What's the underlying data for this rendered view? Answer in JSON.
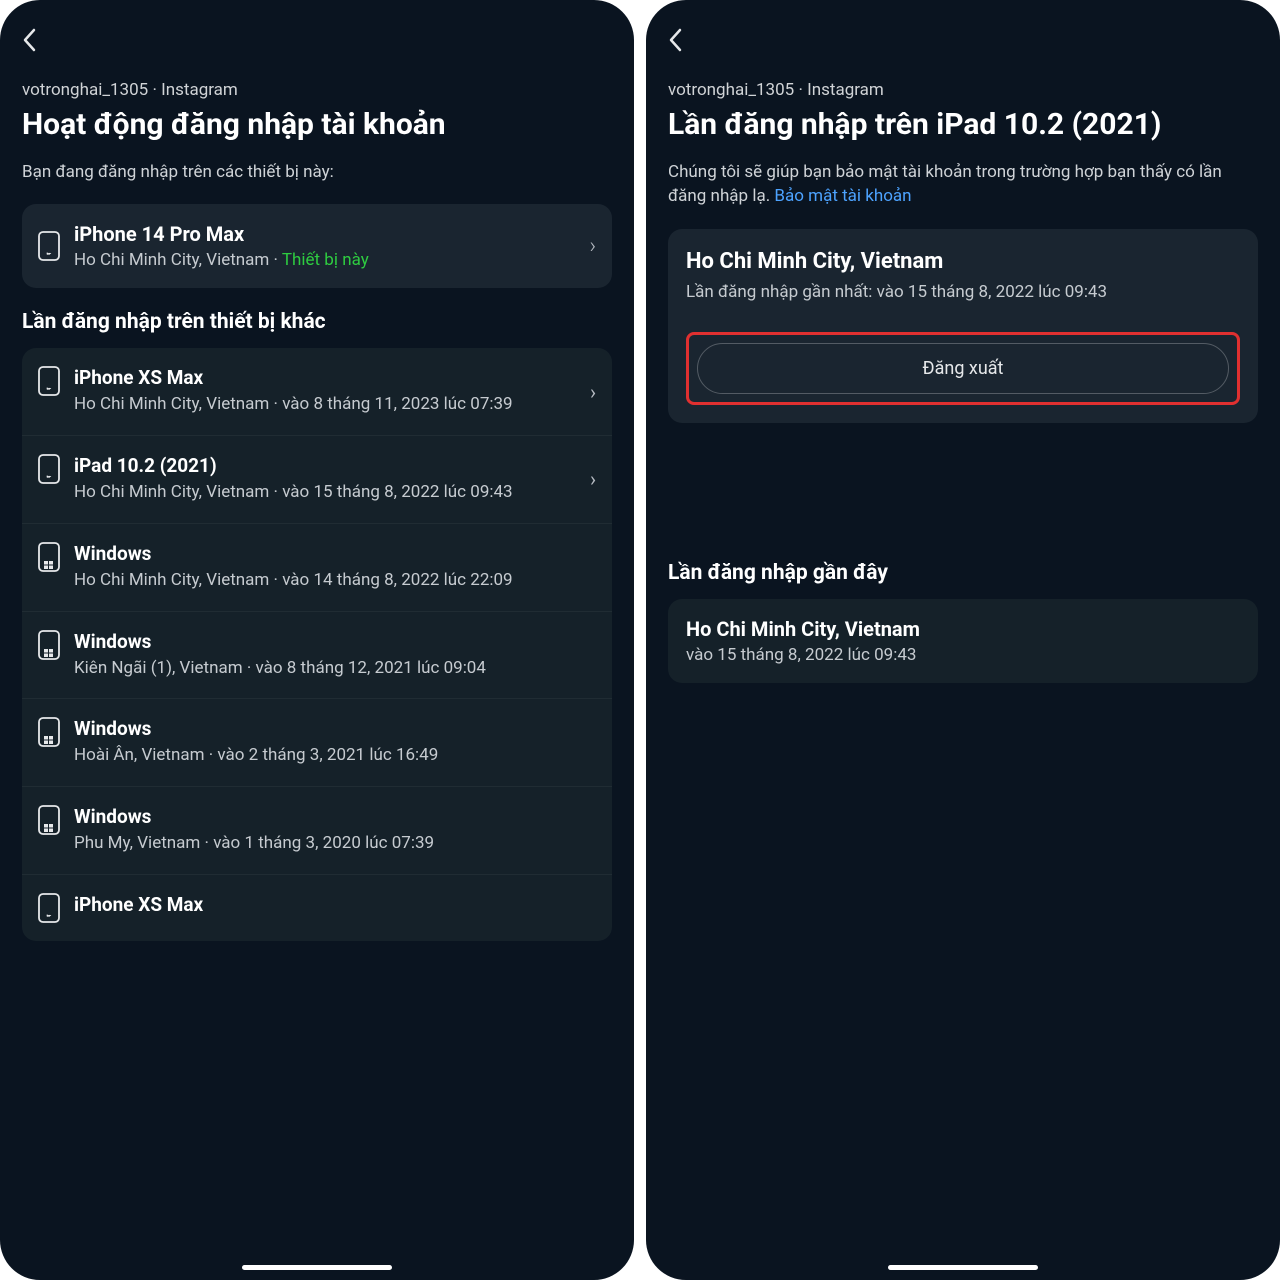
{
  "left": {
    "breadcrumb": "votronghai_1305 · Instagram",
    "title": "Hoạt động đăng nhập tài khoản",
    "subtitle": "Bạn đang đăng nhập trên các thiết bị này:",
    "current": {
      "device": "iPhone 14 Pro Max",
      "location": "Ho Chi Minh City, Vietnam",
      "separator": " · ",
      "this_device": "Thiết bị này"
    },
    "other_heading": "Lần đăng nhập trên thiết bị khác",
    "devices": [
      {
        "name": "iPhone XS Max",
        "sub": "Ho Chi Minh City, Vietnam · vào 8 tháng 11, 2023 lúc 07:39",
        "icon": "apple",
        "chevron": true
      },
      {
        "name": "iPad 10.2 (2021)",
        "sub": "Ho Chi Minh City, Vietnam · vào 15 tháng 8, 2022 lúc 09:43",
        "icon": "apple",
        "chevron": true
      },
      {
        "name": "Windows",
        "sub": "Ho Chi Minh City, Vietnam · vào 14 tháng 8, 2022 lúc 22:09",
        "icon": "windows",
        "chevron": false
      },
      {
        "name": "Windows",
        "sub": "Kiên Ngãi (1), Vietnam · vào 8 tháng 12, 2021 lúc 09:04",
        "icon": "windows",
        "chevron": false
      },
      {
        "name": "Windows",
        "sub": "Hoài Ân, Vietnam · vào 2 tháng 3, 2021 lúc 16:49",
        "icon": "windows",
        "chevron": false
      },
      {
        "name": "Windows",
        "sub": "Phu My, Vietnam · vào 1 tháng 3, 2020 lúc 07:39",
        "icon": "windows",
        "chevron": false
      },
      {
        "name": "iPhone XS Max",
        "sub": "",
        "icon": "apple",
        "chevron": false
      }
    ]
  },
  "right": {
    "breadcrumb": "votronghai_1305 · Instagram",
    "title": "Lần đăng nhập trên iPad 10.2 (2021)",
    "subtitle_text": "Chúng tôi sẽ giúp bạn bảo mật tài khoản trong trường hợp bạn thấy có lần đăng nhập lạ. ",
    "subtitle_link": "Bảo mật tài khoản",
    "detail": {
      "location": "Ho Chi Minh City, Vietnam",
      "last_login": "Lần đăng nhập gần nhất: vào 15 tháng 8, 2022 lúc 09:43"
    },
    "logout_label": "Đăng xuất",
    "recent_heading": "Lần đăng nhập gần đây",
    "recent": {
      "location": "Ho Chi Minh City, Vietnam",
      "time": "vào 15 tháng 8, 2022 lúc 09:43"
    }
  }
}
